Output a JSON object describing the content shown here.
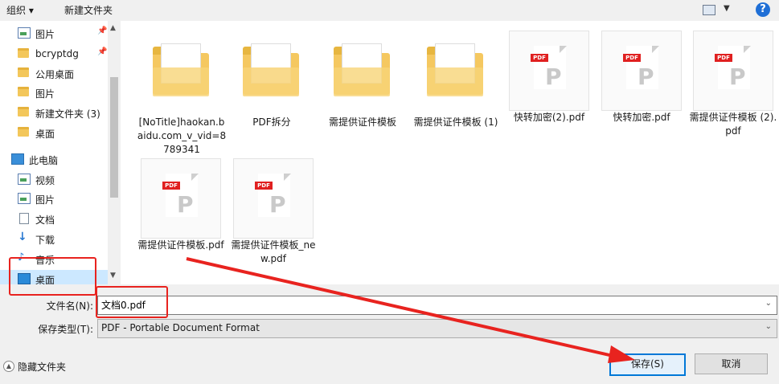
{
  "toolbar": {
    "organize": "组织 ▾",
    "new_folder": "新建文件夹",
    "help": "?"
  },
  "nav": {
    "items": [
      {
        "label": "图片",
        "icon": "picture-icon",
        "pinned": true
      },
      {
        "label": "bcryptdg",
        "icon": "folder-icon",
        "pinned": true
      },
      {
        "label": "公用桌面",
        "icon": "folder-icon",
        "pinned": false
      },
      {
        "label": "图片",
        "icon": "folder-icon",
        "pinned": false
      },
      {
        "label": "新建文件夹 (3)",
        "icon": "folder-icon",
        "pinned": false
      },
      {
        "label": "桌面",
        "icon": "folder-icon",
        "pinned": false
      },
      {
        "label": "此电脑",
        "icon": "computer-icon",
        "pinned": false
      },
      {
        "label": "视频",
        "icon": "video-icon",
        "pinned": false
      },
      {
        "label": "图片",
        "icon": "picture-icon",
        "pinned": false
      },
      {
        "label": "文档",
        "icon": "document-icon",
        "pinned": false
      },
      {
        "label": "下载",
        "icon": "download-icon",
        "pinned": false
      },
      {
        "label": "音乐",
        "icon": "music-icon",
        "pinned": false
      },
      {
        "label": "桌面",
        "icon": "desktop-icon",
        "pinned": false,
        "selected": true
      }
    ]
  },
  "files": [
    {
      "name": "[NoTitle]haokan.baidu.com_v_vid=8789341",
      "type": "folder"
    },
    {
      "name": "PDF拆分",
      "type": "folder"
    },
    {
      "name": "需提供证件模板",
      "type": "folder"
    },
    {
      "name": "需提供证件模板 (1)",
      "type": "folder"
    },
    {
      "name": "快转加密(2).pdf",
      "type": "pdf"
    },
    {
      "name": "快转加密.pdf",
      "type": "pdf"
    },
    {
      "name": "需提供证件模板 (2).pdf",
      "type": "pdf"
    },
    {
      "name": "需提供证件模板.pdf",
      "type": "pdf"
    },
    {
      "name": "需提供证件模板_new.pdf",
      "type": "pdf"
    }
  ],
  "pdf_badge": "PDF",
  "form": {
    "filename_label": "文件名(N):",
    "filename_value": "文档0.pdf",
    "filetype_label": "保存类型(T):",
    "filetype_value": "PDF - Portable Document Format",
    "hide_folders": "隐藏文件夹",
    "save": "保存(S)",
    "cancel": "取消"
  },
  "colors": {
    "annotation": "#e8231f",
    "accent": "#0078d7"
  }
}
